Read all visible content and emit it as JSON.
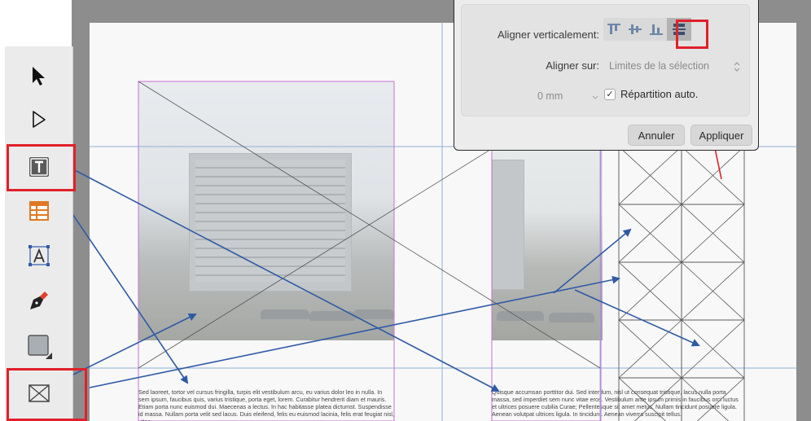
{
  "toolbar": {
    "tools": [
      {
        "name": "move-tool",
        "icon": "arrow-pointer-icon"
      },
      {
        "name": "node-tool",
        "icon": "hollow-pointer-icon"
      },
      {
        "name": "frame-text-tool",
        "icon": "text-frame-icon"
      },
      {
        "name": "table-tool",
        "icon": "table-icon"
      },
      {
        "name": "artistic-text-tool",
        "icon": "artistic-text-icon"
      },
      {
        "name": "pen-tool",
        "icon": "pen-nib-icon"
      },
      {
        "name": "rectangle-tool",
        "icon": "rectangle-icon"
      },
      {
        "name": "picture-frame-tool",
        "icon": "picture-frame-icon"
      }
    ]
  },
  "dialog": {
    "align_vertical_label": "Aligner verticalement:",
    "align_to_label": "Aligner sur:",
    "align_to_value": "Limites de la sélection",
    "spacing_value": "0 mm",
    "auto_distribute_label": "Répartition auto.",
    "auto_distribute_checked": "✓",
    "cancel_label": "Annuler",
    "apply_label": "Appliquer"
  },
  "document": {
    "left_text": "Sed laoreet, tortor vel cursus fringilla, turpis elit vestibulum arcu, eu varius dolor leo in nulla. In sem ipsum, faucibus quis, varius tristique, porta eget, lorem. Curabitur hendrerit diam et mauris. Etiam porta nunc euismod dui. Maecenas a lectus. In hac habitasse platea dictumst. Suspendisse id massa. Nullam porta velit sed lacus. Duis eleifend, felis eu euismod lacinia, felis erat feugiat nisl, vitae",
    "right_text": "Quisque accumsan porttitor dui. Sed interdum, nisl ut consequat tristique, lacus nulla porta massa, sed imperdiet sem nunc vitae eros. Vestibulum ante ipsum primis in faucibus orci luctus et ultrices posuere cubilia Curae; Pellentesque sit amet metus. Nullam tincidunt posuere ligula. Aenean volutpat ultrices ligula. In tincidunt. Aenean viverra suscipit tellus."
  },
  "colors": {
    "highlight": "#e0202a",
    "arrow_blue": "#2f5aa6",
    "frame_magenta": "#c970d6",
    "guide_blue": "#8fb0d6"
  }
}
